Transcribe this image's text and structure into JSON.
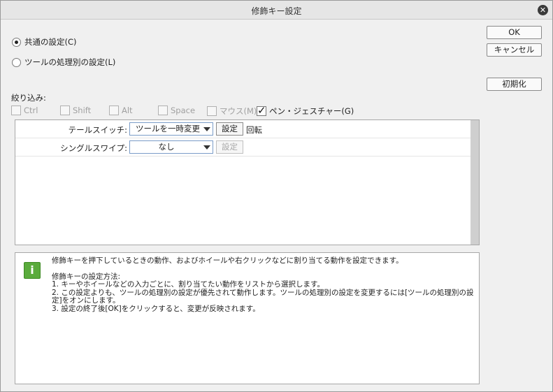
{
  "window": {
    "title": "修飾キー設定",
    "close_glyph": "✕"
  },
  "mode": {
    "common_label": "共通の設定(C)",
    "per_tool_label": "ツールの処理別の設定(L)",
    "selected": "common"
  },
  "buttons": {
    "ok": "OK",
    "cancel": "キャンセル",
    "reset": "初期化"
  },
  "filter": {
    "label": "絞り込み:",
    "options": [
      {
        "label": "Ctrl",
        "checked": false,
        "enabled": false
      },
      {
        "label": "Shift",
        "checked": false,
        "enabled": false
      },
      {
        "label": "Alt",
        "checked": false,
        "enabled": false
      },
      {
        "label": "Space",
        "checked": false,
        "enabled": false
      },
      {
        "label": "マウス(M)",
        "checked": false,
        "enabled": false
      },
      {
        "label": "ペン・ジェスチャー(G)",
        "checked": true,
        "enabled": true
      }
    ]
  },
  "bindings": [
    {
      "label": "テールスイッチ:",
      "action": "ツールを一時変更",
      "set_label": "設定",
      "value": "回転",
      "set_enabled": true
    },
    {
      "label": "シングルスワイプ:",
      "action": "なし",
      "set_label": "設定",
      "value": "",
      "set_enabled": false
    }
  ],
  "info": {
    "icon": "info-icon",
    "lines": [
      "修飾キーを押下しているときの動作、およびホイールや右クリックなどに割り当てる動作を設定できます。",
      "",
      "修飾キーの設定方法:",
      "1. キーやホイールなどの入力ごとに、割り当てたい動作をリストから選択します。",
      "2. この設定よりも、ツールの処理別の設定が優先されて動作します。ツールの処理別の設定を変更するには[ツールの処理別の設",
      "定]をオンにします。",
      "3. 設定の終了後[OK]をクリックすると、変更が反映されます。"
    ]
  }
}
